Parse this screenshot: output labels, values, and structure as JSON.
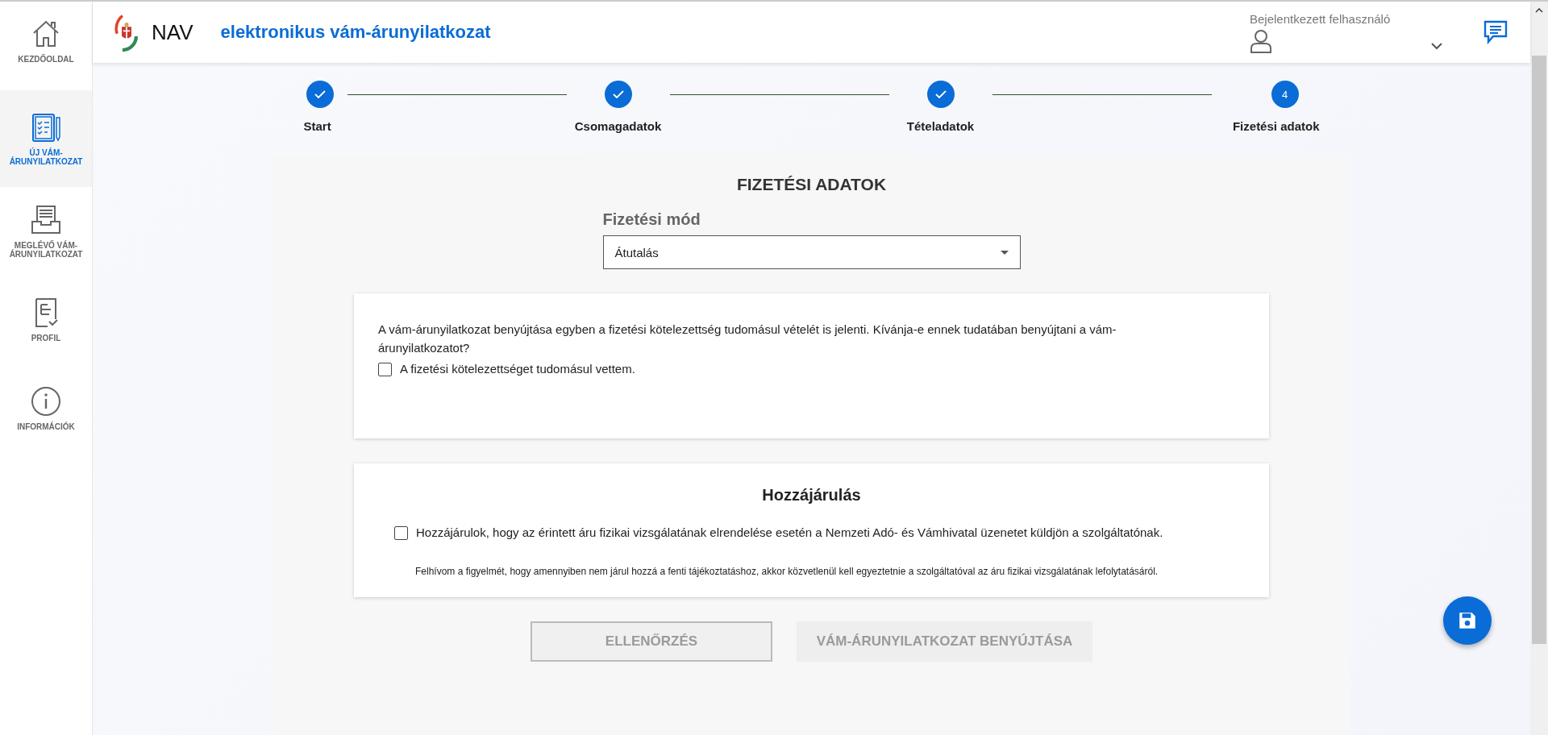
{
  "sidebar": {
    "items": [
      {
        "label": "KEZDŐOLDAL",
        "kind": "home",
        "selected": false
      },
      {
        "label": "ÚJ VÁM-ÁRUNYILATKOZAT",
        "kind": "clipboard",
        "selected": true
      },
      {
        "label": "MEGLÉVŐ VÁM-ÁRUNYILATKOZAT",
        "kind": "tray",
        "selected": false
      },
      {
        "label": "PROFIL",
        "kind": "profile",
        "selected": false
      },
      {
        "label": "INFORMÁCIÓK",
        "kind": "info",
        "selected": false
      }
    ]
  },
  "header": {
    "logo_text": "NAV",
    "app_title": "elektronikus vám-árunyilatkozat",
    "user_label": "Bejelentkezett felhasználó"
  },
  "stepper": {
    "steps": [
      {
        "label": "Start",
        "completed": true
      },
      {
        "label": "Csomagadatok",
        "completed": true
      },
      {
        "label": "Tételadatok",
        "completed": true
      },
      {
        "label": "Fizetési adatok",
        "number": "4",
        "completed": false
      }
    ]
  },
  "form": {
    "title": "FIZETÉSI ADATOK",
    "payment_label": "Fizetési mód",
    "payment_value": "Átutalás",
    "notice_card": {
      "text": "A vám-árunyilatkozat benyújtása egyben a fizetési kötelezettség tudomásul vételét is jelenti. Kívánja-e ennek tudatában benyújtani a vám-árunyilatkozatot?",
      "checkbox": {
        "label": "A fizetési kötelezettséget tudomásul vettem.",
        "checked": false
      }
    },
    "consent_card": {
      "title": "Hozzájárulás",
      "checkbox": {
        "label": "Hozzájárulok, hogy az érintett áru fizikai vizsgálatának elrendelése esetén a Nemzeti Adó- és Vámhivatal üzenetet küldjön a szolgáltatónak.",
        "checked": false
      },
      "note": "Felhívom a figyelmét, hogy amennyiben nem járul hozzá a fenti tájékoztatáshoz, akkor közvetlenül kell egyeztetnie a szolgáltatóval az áru fizikai vizsgálatának lefolytatásáról."
    },
    "buttons": [
      {
        "label": "ELLENŐRZÉS",
        "kind": "outlined",
        "disabled": true
      },
      {
        "label": "VÁM-ÁRUNYILATKOZAT BENYÚJTÁSA",
        "kind": "filled",
        "disabled": true
      }
    ]
  }
}
